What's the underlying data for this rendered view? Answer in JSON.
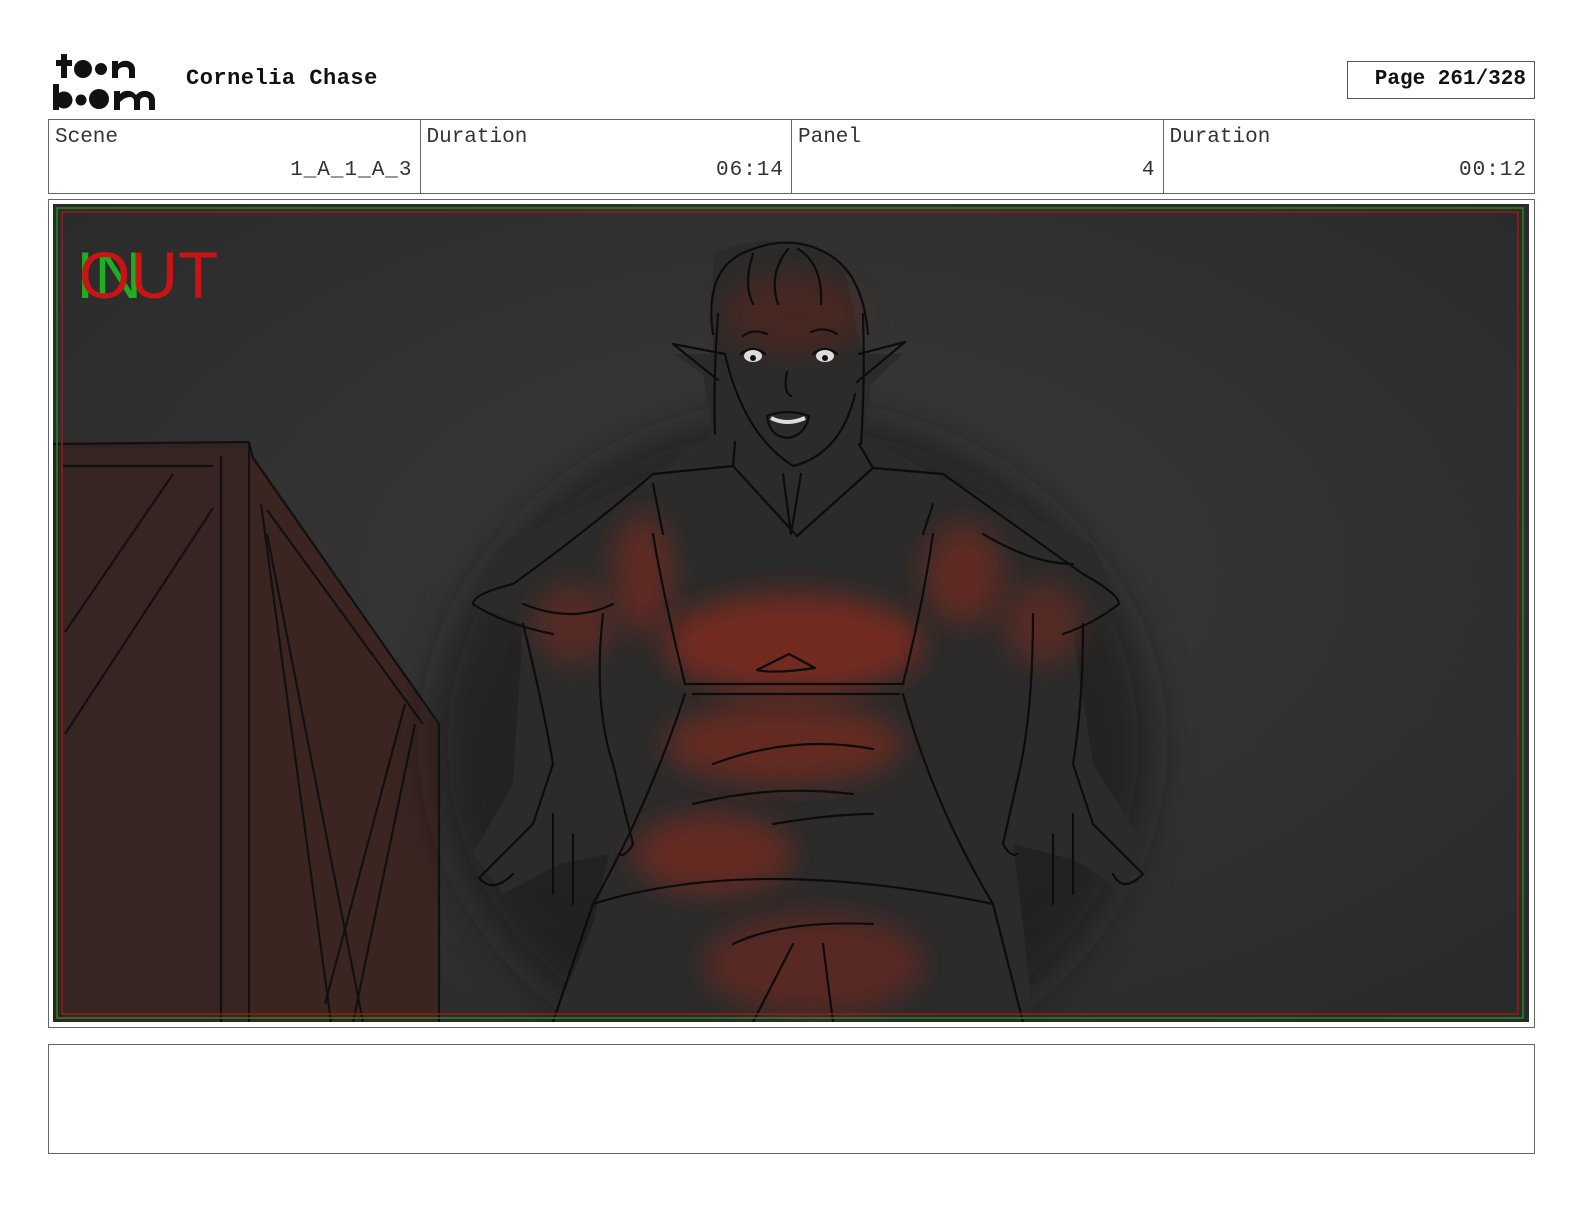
{
  "header": {
    "project_title": "Cornelia Chase",
    "page_label": "Page 261/328"
  },
  "logo": {
    "text_top": "toon",
    "text_bottom": "boom"
  },
  "info": {
    "scene_label": "Scene",
    "scene_value": "1_A_1_A_3",
    "scene_duration_label": "Duration",
    "scene_duration_value": "06:14",
    "panel_label": "Panel",
    "panel_value": "4",
    "panel_duration_label": "Duration",
    "panel_duration_value": "00:12"
  },
  "panel_overlay": {
    "in_text": "IN",
    "out_text": "OUT",
    "in_color": "#1fae1f",
    "out_color": "#c81414"
  },
  "colors": {
    "background_dark": "#2b2b2b",
    "red_glow": "#8a2a1e",
    "safe_frame_green": "#1e8c1e",
    "safe_frame_red": "#a01818"
  },
  "notes": {
    "text": ""
  }
}
